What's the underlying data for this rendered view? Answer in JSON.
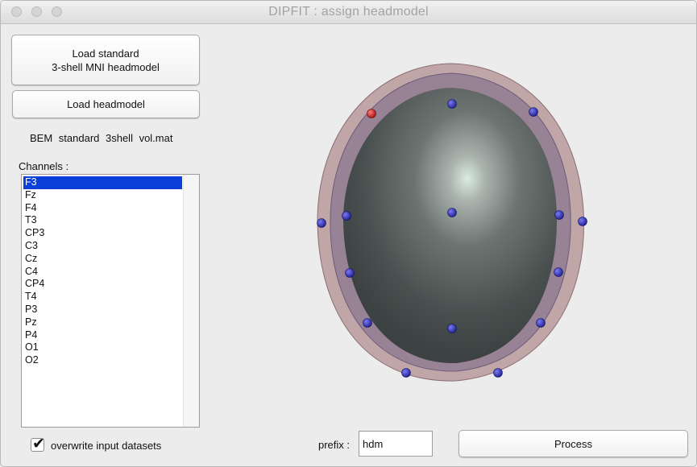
{
  "window": {
    "title": "DIPFIT : assign headmodel"
  },
  "buttons": {
    "load_standard": "Load standard\n3-shell MNI headmodel",
    "load_headmodel": "Load headmodel",
    "process": "Process"
  },
  "volume_file": "BEM  standard  3shell  vol.mat",
  "channels": {
    "label": "Channels :",
    "items": [
      "F3",
      "Fz",
      "F4",
      "T3",
      "CP3",
      "C3",
      "Cz",
      "C4",
      "CP4",
      "T4",
      "P3",
      "Pz",
      "P4",
      "O1",
      "O2"
    ],
    "selected": "F3"
  },
  "overwrite": {
    "label": "overwrite input datasets",
    "checked": true
  },
  "prefix": {
    "label": "prefix :",
    "value": "hdm"
  },
  "colors": {
    "selection": "#0a3fd9",
    "electrode": "#2a2ab8",
    "selected_electrode": "#d21d1d"
  }
}
